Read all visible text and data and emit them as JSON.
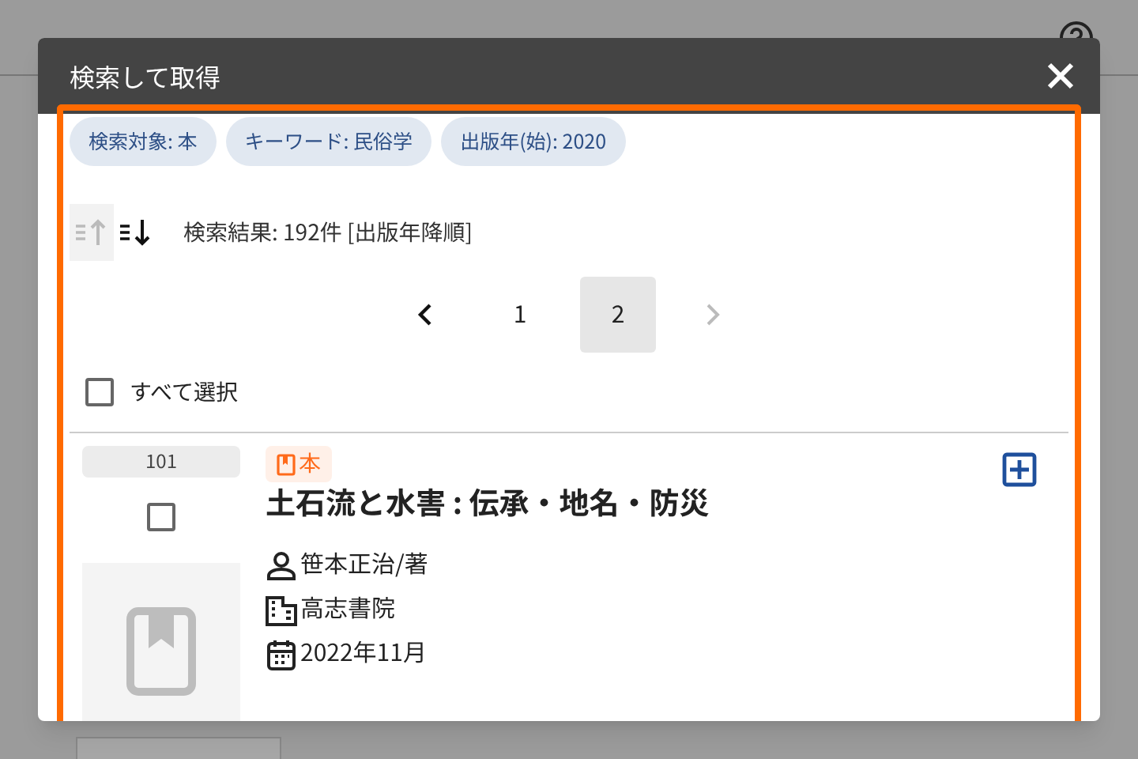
{
  "dialog": {
    "title": "検索して取得",
    "chips": [
      "検索対象: 本",
      "キーワード: 民俗学",
      "出版年(始): 2020"
    ],
    "sort_buttons": [
      {
        "kind": "asc",
        "selected": false
      },
      {
        "kind": "desc",
        "selected": true
      }
    ],
    "result_text": "検索結果: 192件 [出版年降順]",
    "pagination": {
      "prev_disabled": false,
      "next_disabled": true,
      "pages": [
        {
          "label": "1",
          "selected": false
        },
        {
          "label": "2",
          "selected": true
        }
      ]
    },
    "select_all": {
      "label": "すべて選択",
      "checked": false
    },
    "results": [
      {
        "index": "101",
        "checked": false,
        "type_label": "本",
        "title": "土石流と水害 : 伝承・地名・防災",
        "author": "笹本正治/著",
        "publisher": "高志書院",
        "date": "2022年11月"
      }
    ]
  }
}
